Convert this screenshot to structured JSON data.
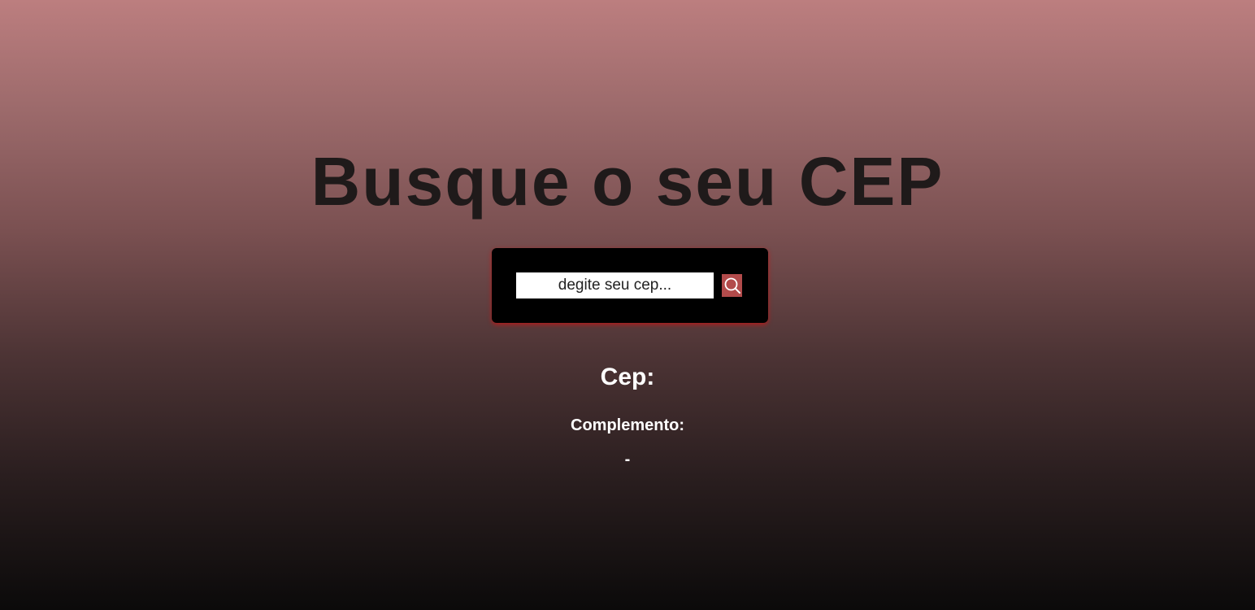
{
  "page": {
    "title": "Busque o seu CEP"
  },
  "search": {
    "placeholder": "degite seu cep...",
    "value": "",
    "button_icon": "search-icon"
  },
  "result": {
    "cep_label": "Cep:",
    "complemento_label": "Complemento:",
    "separator": "-"
  },
  "colors": {
    "background_top": "#bc7e7f",
    "background_bottom": "#0b0a0a",
    "title": "#1f1a1a",
    "panel": "#000000",
    "panel_glow": "#c81414",
    "button": "#b24b4b"
  }
}
